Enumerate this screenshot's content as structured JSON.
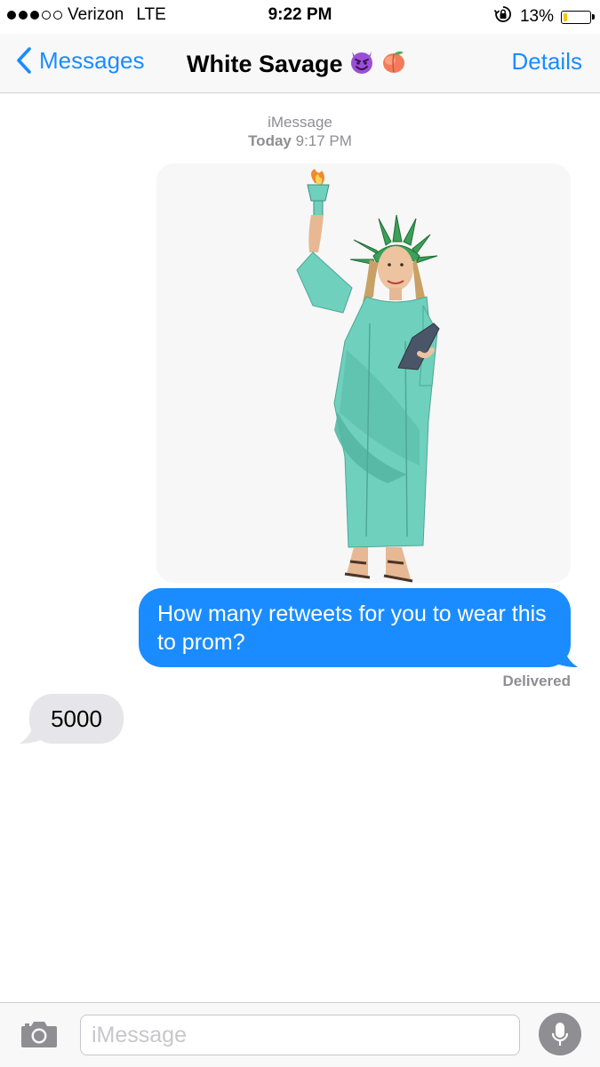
{
  "status_bar": {
    "carrier": "Verizon",
    "network": "LTE",
    "time": "9:22 PM",
    "battery_text": "13%",
    "battery_level": 0.13,
    "signal_bars_filled": 3,
    "signal_bars_total": 5
  },
  "nav": {
    "back_label": "Messages",
    "title": "White Savage",
    "title_emojis": [
      "smiling-devil-emoji",
      "peach-emoji"
    ],
    "details_label": "Details"
  },
  "thread": {
    "service": "iMessage",
    "timestamp_day": "Today",
    "timestamp_time": "9:17 PM",
    "messages": [
      {
        "direction": "outgoing",
        "type": "image",
        "image_description": "statue-of-liberty-costume"
      },
      {
        "direction": "outgoing",
        "type": "text",
        "text": "How many retweets for you to wear this to prom?"
      },
      {
        "direction": "incoming",
        "type": "text",
        "text": "5000"
      }
    ],
    "delivery_status": "Delivered"
  },
  "input_bar": {
    "placeholder": "iMessage",
    "value": ""
  },
  "colors": {
    "accent": "#1a8cff",
    "outgoing_bubble": "#1a8cff",
    "incoming_bubble": "#e5e5ea",
    "meta_text": "#8e8e93",
    "battery_low": "#f2c811"
  }
}
